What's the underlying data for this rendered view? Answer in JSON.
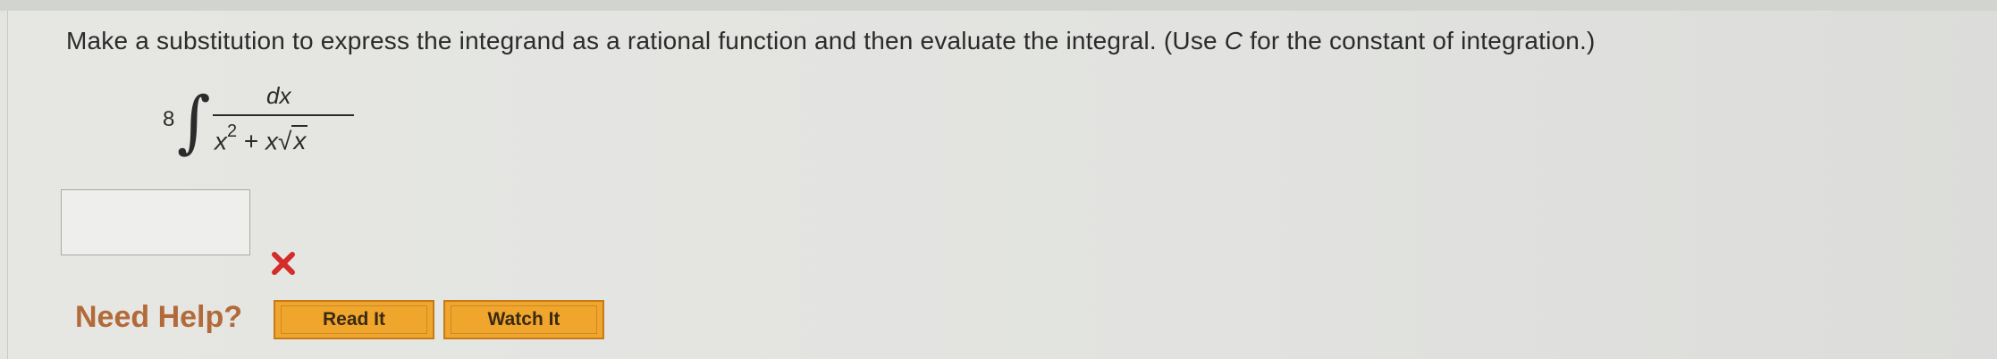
{
  "question": {
    "text_before": "Make a substitution to express the integrand as a rational function and then evaluate the integral. (Use ",
    "text_var": "C",
    "text_after": " for the constant of integration.)"
  },
  "expression": {
    "coefficient": "8",
    "integral_sign": "∫",
    "numerator": "dx",
    "denom_x": "x",
    "denom_power": "2",
    "denom_plus": " + ",
    "denom_x2": "x",
    "sqrt_sign": "√",
    "sqrt_arg": "x"
  },
  "answer": {
    "value": "",
    "status": "incorrect",
    "status_icon": "x-mark-icon",
    "status_color": "#d42b2b"
  },
  "help": {
    "label": "Need Help?",
    "read_label": "Read It",
    "watch_label": "Watch It",
    "button_color": "#f0a52d"
  }
}
